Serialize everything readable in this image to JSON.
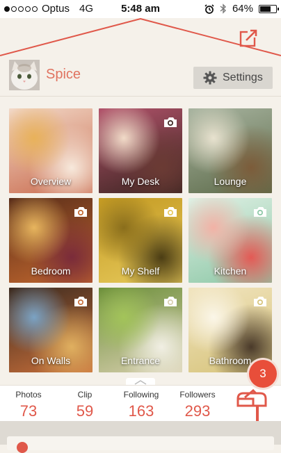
{
  "status_bar": {
    "carrier": "Optus",
    "network": "4G",
    "time": "5:48 am",
    "battery": "64%",
    "battery_level": 0.64,
    "signal_strength": 1
  },
  "profile": {
    "username": "Spice",
    "settings_label": "Settings"
  },
  "rooms": [
    {
      "label": "Overview",
      "camera": false,
      "colors": [
        "#f2d9c8",
        "#c96b4e",
        "#e8b25a",
        "#f7e9dc"
      ]
    },
    {
      "label": "My Desk",
      "camera": true,
      "colors": [
        "#b2536b",
        "#3a2420",
        "#f1dbc8",
        "#6b3b34"
      ]
    },
    {
      "label": "Lounge",
      "camera": false,
      "colors": [
        "#a8b4a0",
        "#5d6b4a",
        "#e8e2cf",
        "#7c5c3a"
      ]
    },
    {
      "label": "Bedroom",
      "camera": true,
      "colors": [
        "#5a2e1a",
        "#c2672e",
        "#e7b55e",
        "#7a2b3a"
      ]
    },
    {
      "label": "My Shelf",
      "camera": true,
      "colors": [
        "#c49a22",
        "#e6c95b",
        "#8a6e1c",
        "#4b3d14"
      ]
    },
    {
      "label": "Kitchen",
      "camera": true,
      "colors": [
        "#dff0e4",
        "#8cc7a6",
        "#f2b2a6",
        "#e35a55"
      ]
    },
    {
      "label": "On Walls",
      "camera": true,
      "colors": [
        "#3b2a1f",
        "#c96f3a",
        "#7ba3c4",
        "#e0b060"
      ]
    },
    {
      "label": "Entrance",
      "camera": true,
      "colors": [
        "#6c8f3a",
        "#d8cfae",
        "#a3c45a",
        "#f1efe4"
      ]
    },
    {
      "label": "Bathroom",
      "camera": true,
      "colors": [
        "#f1e4bf",
        "#d6c37a",
        "#fbf6e8",
        "#4a3a2a"
      ]
    }
  ],
  "stats": [
    {
      "name": "Photos",
      "value": "73"
    },
    {
      "name": "Clip",
      "value": "59"
    },
    {
      "name": "Following",
      "value": "163"
    },
    {
      "name": "Followers",
      "value": "293"
    }
  ],
  "mailbox": {
    "badge_count": "3",
    "icon": "mailbox-icon"
  },
  "icons": {
    "share": "share-icon",
    "settings": "gear-icon",
    "camera": "camera-icon",
    "pull_tab": "chevron-up-icon"
  },
  "colors": {
    "accent": "#e0584a",
    "username": "#e07360",
    "background": "#f5f1ea"
  }
}
